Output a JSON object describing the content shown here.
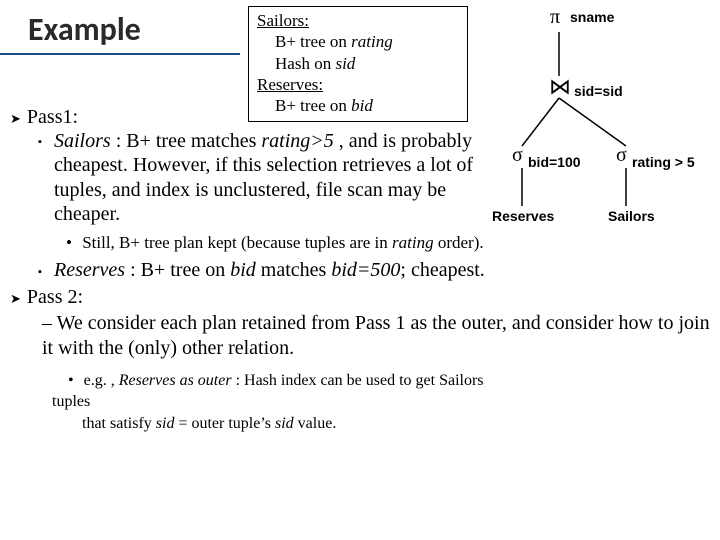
{
  "title": "Example",
  "infobox": {
    "sailors_heading": "Sailors:",
    "sailors_idx1_a": "B+ tree on ",
    "sailors_idx1_b": "rating",
    "sailors_idx2_a": "Hash on ",
    "sailors_idx2_b": "sid",
    "reserves_heading": "Reserves:",
    "reserves_idx1_a": "B+ tree on ",
    "reserves_idx1_b": "bid"
  },
  "tree": {
    "project_sym": "π",
    "project_attr": "sname",
    "join_sym": "⋈",
    "join_cond": "sid=sid",
    "sigma_sym": "σ",
    "select_left": "bid=100",
    "select_right": "rating > 5",
    "leaf_left": "Reserves",
    "leaf_right": "Sailors"
  },
  "pass1": {
    "heading": "Pass1:",
    "sailors_lead_a": "Sailors",
    "sailors_lead_b": " :   B+ tree matches ",
    "sailors_lead_c": "rating>5",
    "sailors_lead_d": " , and is probably cheapest.  However, if this selection retrieves a lot of tuples, and index is unclustered, file scan may be cheaper.",
    "still_a": "Still, B+ tree plan kept (because tuples are in ",
    "still_b": "rating",
    "still_c": "  order).",
    "reserves_a": "Reserves",
    "reserves_b": "  :   B+ tree on ",
    "reserves_c": "bid",
    "reserves_d": "  matches ",
    "reserves_e": "bid=500",
    "reserves_f": "; cheapest."
  },
  "pass2": {
    "heading": "Pass 2:",
    "body_dash": "– ",
    "body": "We consider each plan retained from Pass 1 as the outer, and consider how to join it with the (only) other relation.",
    "eg_a": "e.g. , ",
    "eg_b": "Reserves as outer",
    "eg_c": "   :  Hash index can be used to get Sailors",
    "eg_tuples": "tuples",
    "eg_cond_a": "that satisfy ",
    "eg_cond_b": "sid",
    "eg_cond_c": "  = outer tuple’s ",
    "eg_cond_d": "sid",
    "eg_cond_e": "  value."
  }
}
